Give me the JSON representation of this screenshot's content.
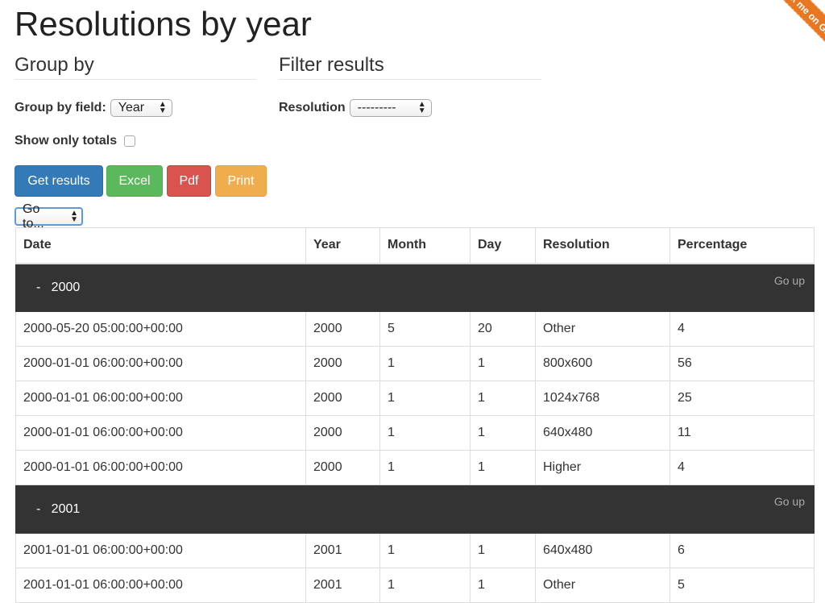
{
  "page": {
    "title": "Resolutions by year"
  },
  "ribbon": {
    "text": "Fork me on GitHub"
  },
  "group_by": {
    "heading": "Group by",
    "field_label": "Group by field:",
    "field_value": "Year",
    "totals_label": "Show only totals",
    "totals_checked": false
  },
  "filter": {
    "heading": "Filter results",
    "resolution_label": "Resolution",
    "resolution_value": "---------"
  },
  "buttons": {
    "get_results": "Get results",
    "excel": "Excel",
    "pdf": "Pdf",
    "print": "Print"
  },
  "goto": {
    "value": "Go to..."
  },
  "table": {
    "headers": [
      "Date",
      "Year",
      "Month",
      "Day",
      "Resolution",
      "Percentage"
    ],
    "go_up": "Go up",
    "groups": [
      {
        "label": "-   2000",
        "rows": [
          [
            "2000-05-20 05:00:00+00:00",
            "2000",
            "5",
            "20",
            "Other",
            "4"
          ],
          [
            "2000-01-01 06:00:00+00:00",
            "2000",
            "1",
            "1",
            "800x600",
            "56"
          ],
          [
            "2000-01-01 06:00:00+00:00",
            "2000",
            "1",
            "1",
            "1024x768",
            "25"
          ],
          [
            "2000-01-01 06:00:00+00:00",
            "2000",
            "1",
            "1",
            "640x480",
            "11"
          ],
          [
            "2000-01-01 06:00:00+00:00",
            "2000",
            "1",
            "1",
            "Higher",
            "4"
          ]
        ]
      },
      {
        "label": "-   2001",
        "rows": [
          [
            "2001-01-01 06:00:00+00:00",
            "2001",
            "1",
            "1",
            "640x480",
            "6"
          ],
          [
            "2001-01-01 06:00:00+00:00",
            "2001",
            "1",
            "1",
            "Other",
            "5"
          ]
        ]
      }
    ]
  },
  "colors": {
    "primary": "#337ab7",
    "success": "#5cb85c",
    "danger": "#d9534f",
    "warning": "#f0ad4e",
    "group_row": "#333333",
    "ribbon": "#e87722"
  }
}
